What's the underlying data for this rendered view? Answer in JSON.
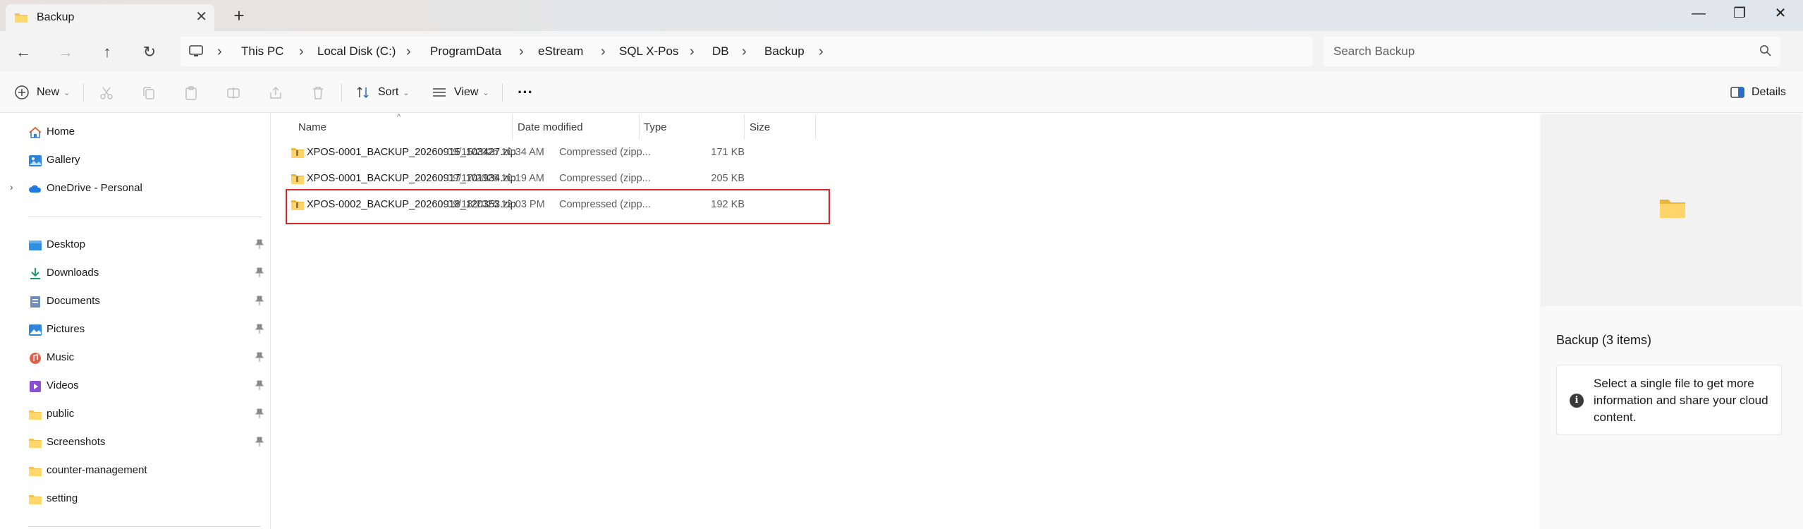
{
  "window": {
    "tab_title": "Backup",
    "tab_close": "✕",
    "new_tab": "+",
    "minimize": "—",
    "restore": "❐",
    "close": "✕"
  },
  "nav": {
    "back": "←",
    "forward": "→",
    "up": "↑",
    "refresh": "↻"
  },
  "address": {
    "separator": "›",
    "segments": [
      "This PC",
      "Local Disk (C:)",
      "ProgramData",
      "eStream",
      "SQL X-Pos",
      "DB",
      "Backup"
    ]
  },
  "search": {
    "placeholder": "Search Backup"
  },
  "commands": {
    "new_label": "New",
    "sort_label": "Sort",
    "view_label": "View",
    "more_label": "···",
    "details_label": "Details",
    "chevron": "⌄"
  },
  "sidebar": {
    "quick": [
      {
        "label": "Home",
        "icon": "home-icon"
      },
      {
        "label": "Gallery",
        "icon": "gallery-icon"
      },
      {
        "label": "OneDrive - Personal",
        "icon": "onedrive-icon"
      }
    ],
    "pinned": [
      {
        "label": "Desktop",
        "icon": "desktop-icon"
      },
      {
        "label": "Downloads",
        "icon": "downloads-icon"
      },
      {
        "label": "Documents",
        "icon": "documents-icon"
      },
      {
        "label": "Pictures",
        "icon": "pictures-icon"
      },
      {
        "label": "Music",
        "icon": "music-icon"
      },
      {
        "label": "Videos",
        "icon": "videos-icon"
      },
      {
        "label": "public",
        "icon": "folder-icon"
      },
      {
        "label": "Screenshots",
        "icon": "folder-icon"
      },
      {
        "label": "counter-management",
        "icon": "folder-icon"
      },
      {
        "label": "setting",
        "icon": "folder-icon"
      }
    ],
    "pin_glyph": "📌",
    "expander": "›"
  },
  "files": {
    "columns": [
      "Name",
      "Date modified",
      "Type",
      "Size"
    ],
    "sort_caret": "^",
    "rows": [
      {
        "name": "XPOS-0001_BACKUP_20260915_103427.zip",
        "date": "09/15/2026 10:34 AM",
        "type": "Compressed (zipp...",
        "size": "171 KB"
      },
      {
        "name": "XPOS-0001_BACKUP_20260917_101934.zip",
        "date": "09/17/2026 10:19 AM",
        "type": "Compressed (zipp...",
        "size": "205 KB"
      },
      {
        "name": "XPOS-0002_BACKUP_20260918_120353.zip",
        "date": "09/18/2026 12:03 PM",
        "type": "Compressed (zipp...",
        "size": "192 KB"
      }
    ],
    "highlight_color": "#d9262b"
  },
  "details": {
    "title": "Backup (3 items)",
    "info_icon": "i",
    "info_text": "Select a single file to get more information and share your cloud content."
  }
}
